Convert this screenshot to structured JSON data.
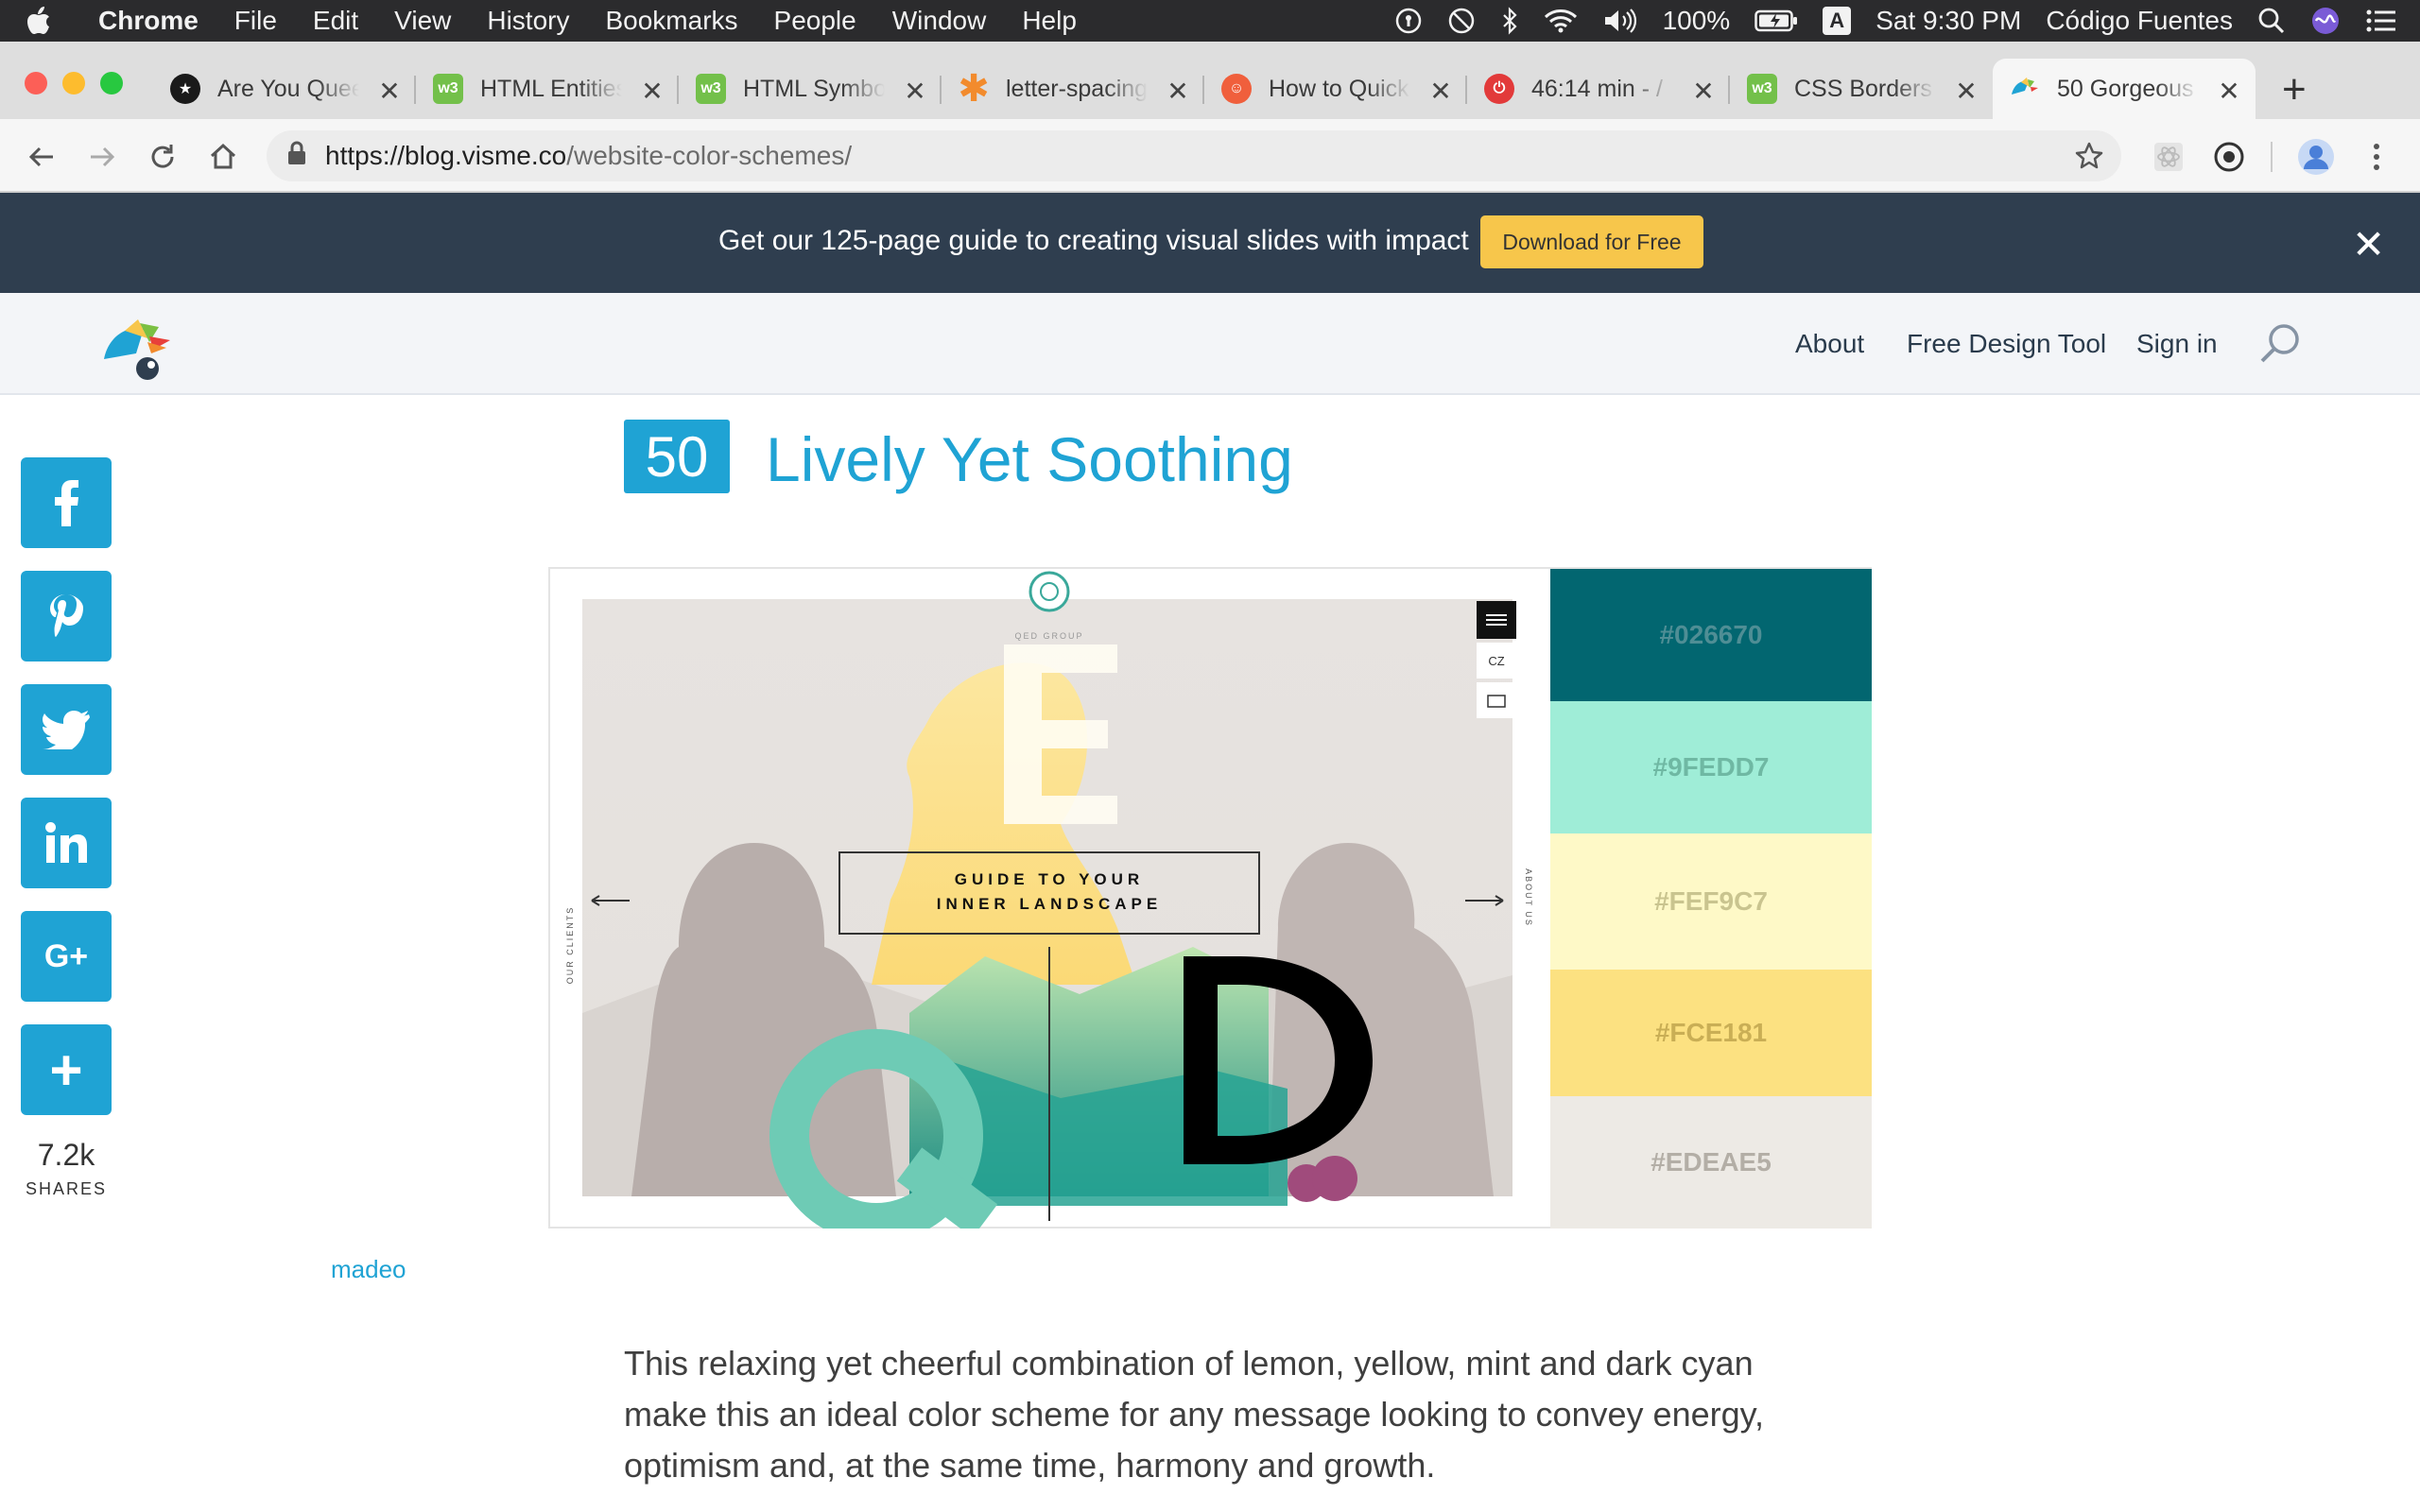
{
  "menubar": {
    "app": "Chrome",
    "items": [
      "File",
      "Edit",
      "View",
      "History",
      "Bookmarks",
      "People",
      "Window",
      "Help"
    ],
    "battery": "100%",
    "input_source": "A",
    "clock": "Sat 9:30 PM",
    "user": "Código Fuentes"
  },
  "tabs": [
    {
      "title": "Are You Queer",
      "favicon": "star-icon"
    },
    {
      "title": "HTML Entities",
      "favicon": "w3-icon"
    },
    {
      "title": "HTML Symbols",
      "favicon": "w3-icon"
    },
    {
      "title": "letter-spacing",
      "favicon": "asterisk-icon"
    },
    {
      "title": "How to Quickly",
      "favicon": "face-icon"
    },
    {
      "title": "46:14 min - /",
      "favicon": "power-icon"
    },
    {
      "title": "CSS Borders",
      "favicon": "w3-icon"
    },
    {
      "title": "50 Gorgeous",
      "favicon": "visme-icon"
    }
  ],
  "toolbar": {
    "url_host": "https://blog.visme.co",
    "url_path": "/website-color-schemes/"
  },
  "promo": {
    "text": "Get our 125-page guide to creating visual slides with impact",
    "button": "Download for Free"
  },
  "nav": {
    "links": [
      "About",
      "Free Design Tool",
      "Sign in"
    ]
  },
  "share": {
    "count": "7.2k",
    "label": "SHARES"
  },
  "article": {
    "number": "50",
    "title": "Lively Yet Soothing",
    "credit": "madeo",
    "body": "This relaxing yet cheerful combination of lemon, yellow, mint and dark cyan make this an ideal color scheme for any message looking to convey energy, optimism and, at the same time, harmony and growth."
  },
  "palette": [
    {
      "hex": "#026670",
      "text_color": "#4f8e95"
    },
    {
      "hex": "#9FEDD7",
      "text_color": "#6fb8a3"
    },
    {
      "hex": "#FEF9C7",
      "text_color": "#c9c48f"
    },
    {
      "hex": "#FCE181",
      "text_color": "#c9ae55"
    },
    {
      "hex": "#EDEAE5",
      "text_color": "#b3aea6"
    }
  ],
  "mockup": {
    "brand": "QED GROUP",
    "headline_line1": "GUIDE TO YOUR",
    "headline_line2": "INNER LANDSCAPE",
    "left_label": "OUR CLIENTS",
    "right_label": "ABOUT US",
    "lang": "CZ",
    "letters": [
      "E",
      "Q",
      "D"
    ]
  }
}
